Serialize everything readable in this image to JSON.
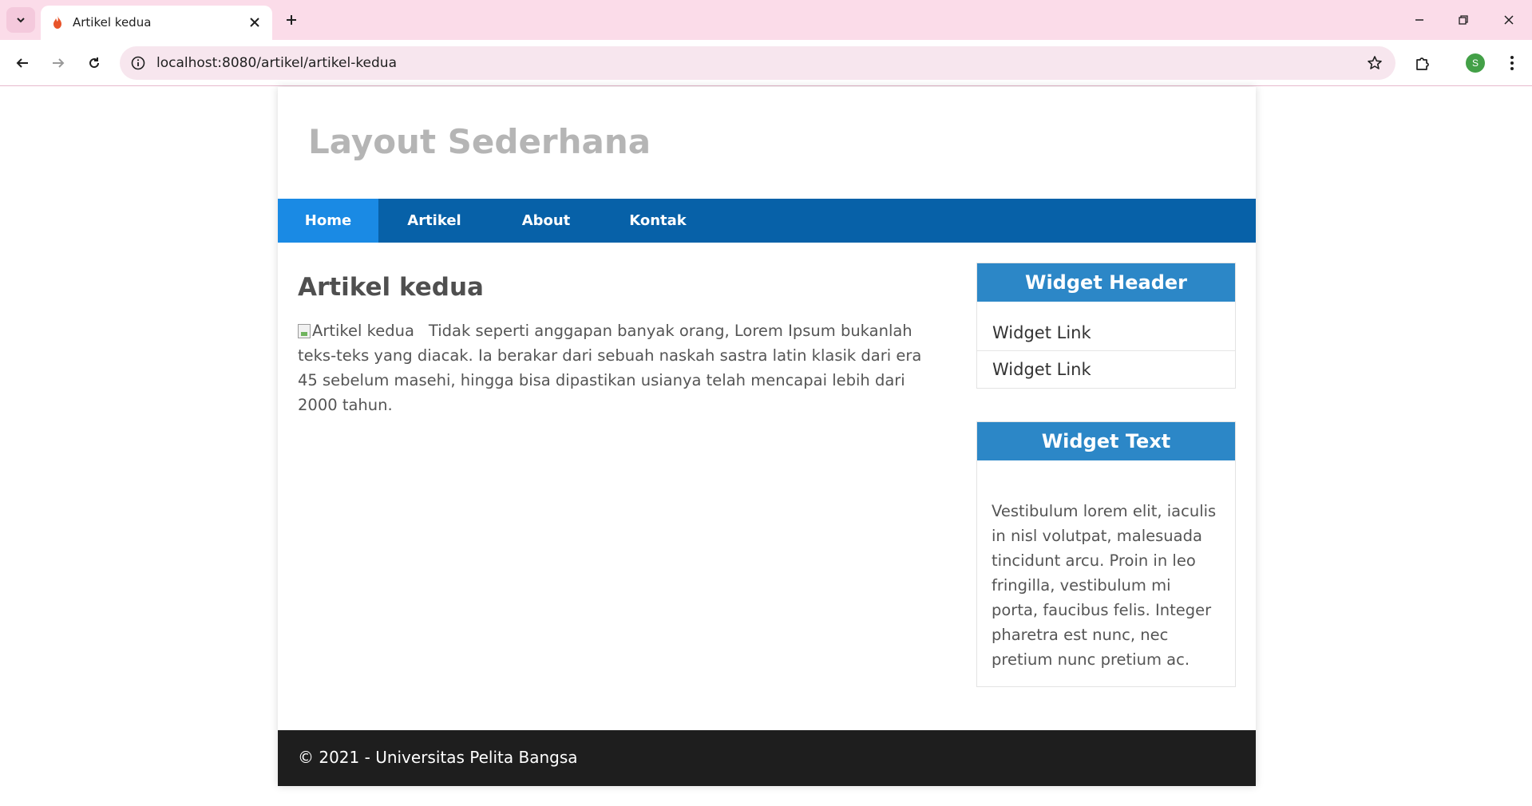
{
  "browser": {
    "tab_title": "Artikel kedua",
    "url": "localhost:8080/artikel/artikel-kedua",
    "profile_initial": "S"
  },
  "site": {
    "title": "Layout Sederhana",
    "nav": [
      {
        "label": "Home"
      },
      {
        "label": "Artikel"
      },
      {
        "label": "About"
      },
      {
        "label": "Kontak"
      }
    ]
  },
  "article": {
    "title": "Artikel kedua",
    "image_alt": "Artikel kedua",
    "body": "Tidak seperti anggapan banyak orang, Lorem Ipsum bukanlah teks-teks yang diacak. Ia berakar dari sebuah naskah sastra latin klasik dari era 45 sebelum masehi, hingga bisa dipastikan usianya telah mencapai lebih dari 2000 tahun."
  },
  "sidebar": {
    "widget_header": {
      "title": "Widget Header",
      "links": [
        "Widget Link",
        "Widget Link"
      ]
    },
    "widget_text": {
      "title": "Widget Text",
      "text": "Vestibulum lorem elit, iaculis in nisl volutpat, malesuada tincidunt arcu. Proin in leo fringilla, vestibulum mi porta, faucibus felis. Integer pharetra est nunc, nec pretium nunc pretium ac."
    }
  },
  "footer": {
    "text": "© 2021 - Universitas Pelita Bangsa"
  },
  "colors": {
    "nav_bg": "#0761a8",
    "nav_active": "#1a8ae4",
    "widget_header_bg": "#2c87c7",
    "footer_bg": "#1e1e1e",
    "tabbar_bg": "#fbdce9"
  }
}
